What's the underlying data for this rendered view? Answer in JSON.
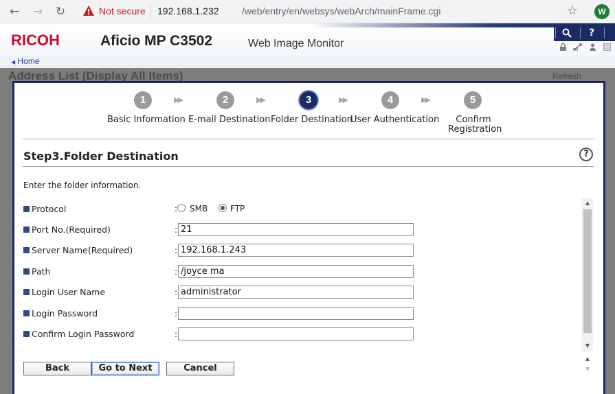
{
  "browser": {
    "security_label": "Not secure",
    "url_host": "192.168.1.232",
    "url_path": "/web/entry/en/websys/webArch/mainFrame.cgi",
    "profile_initial": "W"
  },
  "header": {
    "brand": "RICOH",
    "model": "Aficio MP C3502",
    "app_name": "Web Image Monitor",
    "home_link": "Home",
    "brand_color": "#cf0a2c",
    "accent_color": "#1b2a63"
  },
  "background_page": {
    "title": "Address List (Display All Items)",
    "refresh_label": "Refresh"
  },
  "steps": [
    {
      "number": "1",
      "label": "Basic Information",
      "active": false
    },
    {
      "number": "2",
      "label": "E-mail Destination",
      "active": false
    },
    {
      "number": "3",
      "label": "Folder Destination",
      "active": true
    },
    {
      "number": "4",
      "label": "User Authentication",
      "active": false
    },
    {
      "number": "5",
      "label_line1": "Confirm",
      "label_line2": "Registration",
      "active": false
    }
  ],
  "form": {
    "title": "Step3.Folder Destination",
    "instruction": "Enter the folder information.",
    "protocol_label": "Protocol",
    "protocol_options": [
      "SMB",
      "FTP"
    ],
    "protocol_selected": "FTP",
    "fields": [
      {
        "label": "Port No.(Required)",
        "value": "21"
      },
      {
        "label": "Server Name(Required)",
        "value": "192.168.1.243"
      },
      {
        "label": "Path",
        "value": "/joyce ma"
      },
      {
        "label": "Login User Name",
        "value": "administrator"
      },
      {
        "label": "Login Password",
        "value": ""
      },
      {
        "label": "Confirm Login Password",
        "value": ""
      }
    ]
  },
  "buttons": {
    "back": "Back",
    "next": "Go to Next",
    "cancel": "Cancel"
  }
}
